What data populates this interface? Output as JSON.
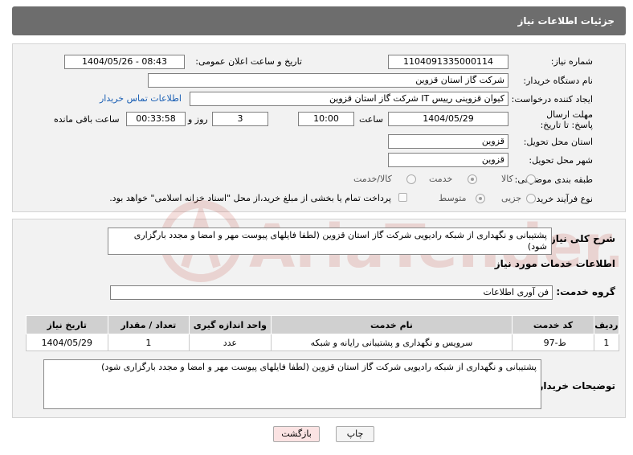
{
  "header": {
    "title": "جزئیات اطلاعات نیاز"
  },
  "form": {
    "need_number_label": "شماره نیاز:",
    "need_number": "1104091335000114",
    "announce_label": "تاریخ و ساعت اعلان عمومی:",
    "announce_value": "1404/05/26 - 08:43",
    "buyer_org_label": "نام دستگاه خریدار:",
    "buyer_org": "شرکت گاز استان قزوین",
    "creator_label": "ایجاد کننده درخواست:",
    "creator": "کیوان قزوینی رییس IT شرکت گاز استان قزوین",
    "contact_link": "اطلاعات تماس خریدار",
    "deadline_label": "مهلت ارسال پاسخ: تا تاریخ:",
    "deadline_date": "1404/05/29",
    "time_label": "ساعت",
    "deadline_time": "10:00",
    "days_value": "3",
    "days_label": "روز و",
    "remaining_time": "00:33:58",
    "remaining_label": "ساعت باقی مانده",
    "province_label": "استان محل تحویل:",
    "province": "قزوین",
    "city_label": "شهر محل تحویل:",
    "city": "قزوین",
    "category_label": "طبقه بندی موضوعی:",
    "category_options": [
      "کالا",
      "خدمت",
      "کالا/خدمت"
    ],
    "category_selected": "خدمت",
    "process_label": "نوع فرآیند خرید :",
    "process_options": [
      "جزیی",
      "متوسط"
    ],
    "process_selected": "متوسط",
    "payment_note": "پرداخت تمام یا بخشی از مبلغ خرید،از محل \"اسناد خزانه اسلامی\" خواهد بود."
  },
  "summary": {
    "label": "شرح کلی نیاز:",
    "text": "پشتیبانی و نگهداری از شبکه رادیویی شرکت گاز استان قزوین (لطفا فایلهای پیوست مهر و امضا و  مجدد بارگزاری شود)"
  },
  "services": {
    "section_title": "اطلاعات خدمات مورد نیاز",
    "group_label": "گروه خدمت:",
    "group_value": "فن آوری اطلاعات",
    "columns": [
      "ردیف",
      "کد خدمت",
      "نام خدمت",
      "واحد اندازه گیری",
      "تعداد / مقدار",
      "تاریخ نیاز"
    ],
    "rows": [
      {
        "row": "1",
        "code": "ط-97",
        "name": "سرویس و نگهداری و پشتیبانی رایانه و شبکه",
        "unit": "عدد",
        "qty": "1",
        "date": "1404/05/29"
      }
    ]
  },
  "buyer_notes": {
    "label": "توضیحات خریدار:",
    "text": "پشتیبانی و نگهداری از شبکه رادیویی شرکت گاز استان قزوین (لطفا فایلهای پیوست مهر و امضا و  مجدد بارگزاری شود)"
  },
  "buttons": {
    "print": "چاپ",
    "back": "بازگشت"
  },
  "watermark_text": "AriaTender.neT",
  "colors": {
    "header_bg": "#6d6d6d",
    "panel_bg": "#f2f2f2",
    "link": "#1a5fb4",
    "back_button_bg": "#fbe3e3"
  }
}
